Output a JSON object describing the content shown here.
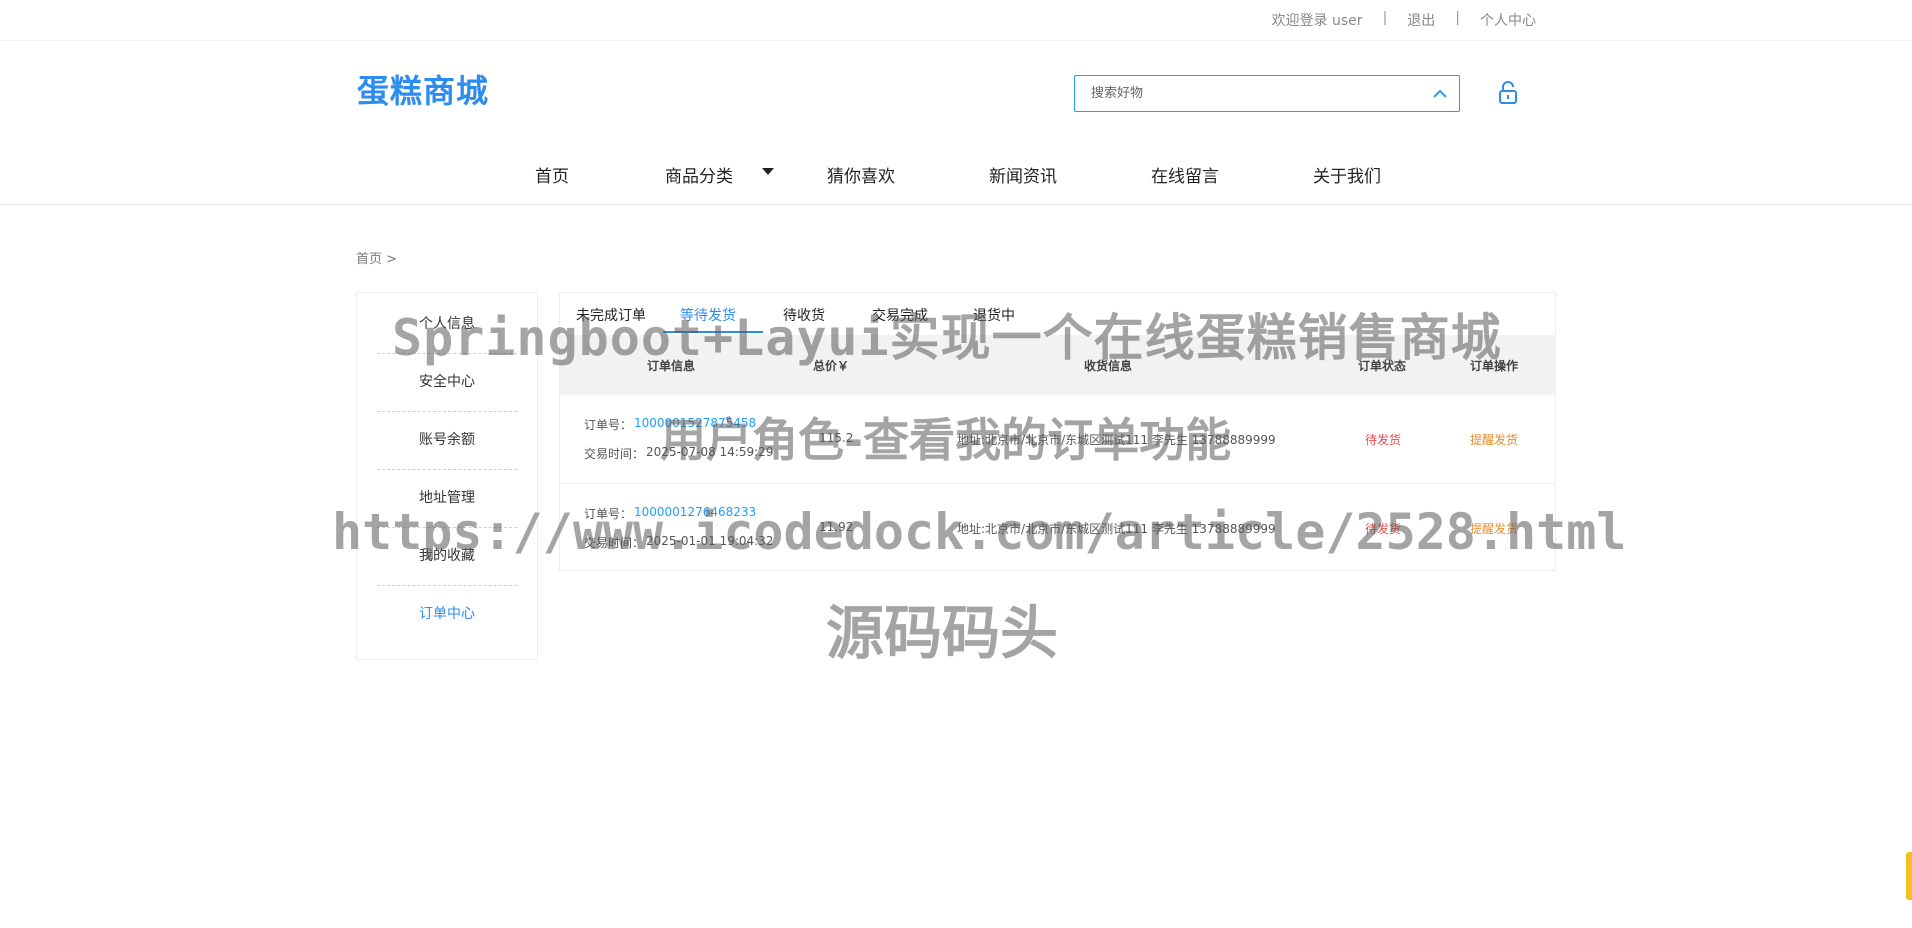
{
  "topbar": {
    "welcome": "欢迎登录 user",
    "sep": "|",
    "logout": "退出",
    "profile": "个人中心"
  },
  "header": {
    "logo": "蛋糕商城",
    "search_placeholder": "搜索好物"
  },
  "nav": [
    {
      "label": "首页"
    },
    {
      "label": "商品分类"
    },
    {
      "label": "猜你喜欢"
    },
    {
      "label": "新闻资讯"
    },
    {
      "label": "在线留言"
    },
    {
      "label": "关于我们"
    }
  ],
  "breadcrumb": "首页 >",
  "sidebar": [
    {
      "label": "个人信息"
    },
    {
      "label": "安全中心"
    },
    {
      "label": "账号余额"
    },
    {
      "label": "地址管理"
    },
    {
      "label": "我的收藏"
    },
    {
      "label": "订单中心"
    }
  ],
  "tabs": [
    {
      "label": "未完成订单"
    },
    {
      "label": "等待发货"
    },
    {
      "label": "待收货"
    },
    {
      "label": "交易完成"
    },
    {
      "label": "退货中"
    }
  ],
  "table": {
    "headers": [
      "订单信息",
      "总价￥",
      "收货信息",
      "订单状态",
      "订单操作"
    ],
    "rows": [
      {
        "order_label": "订单号：",
        "order_no": "1000001527875458",
        "time_label": "交易时间：",
        "time": "2025-07-08 14:59:29",
        "total": "115.2",
        "address": "地址:北京市/北京市/东城区测试111 李先生 13788889999",
        "status": "待发货",
        "action": "提醒发货"
      },
      {
        "order_label": "订单号：",
        "order_no": "1000001276468233",
        "time_label": "交易时间：",
        "time": "2025-01-01 19:04:32",
        "total": "11.92",
        "address": "地址:北京市/北京市/东城区测试111 李先生 13788889999",
        "status": "待发货",
        "action": "提醒发货"
      }
    ]
  },
  "watermark": {
    "line1": "Springboot+Layui实现一个在线蛋糕销售商城",
    "line2": "用户角色-查看我的订单功能",
    "line3": "https://www.icodedock.com/article/2528.html",
    "line4": "源码码头"
  },
  "colors": {
    "accent": "#2d8cf0",
    "link": "#1e9fff",
    "status": "#e24b4b",
    "action": "#e98c2a"
  },
  "icons": {
    "search_toggle": "chevron-up-icon",
    "cart": "lock-icon",
    "nav_dropdown": "caret-down-icon"
  }
}
